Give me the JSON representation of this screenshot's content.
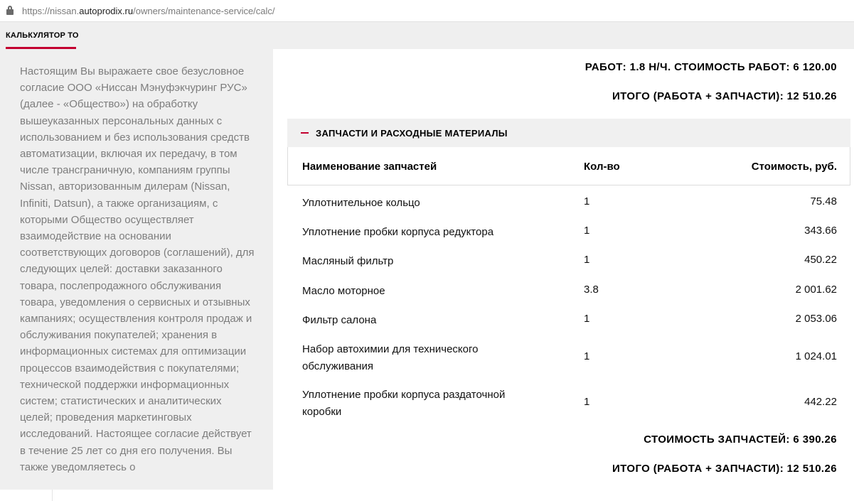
{
  "browser": {
    "url_prefix": "https://nissan.",
    "url_domain": "autoprodix.ru",
    "url_path": "/owners/maintenance-service/calc/"
  },
  "tab": {
    "label": "КАЛЬКУЛЯТОР ТО"
  },
  "consent": {
    "text": "Настоящим Вы выражаете свое безусловное согласие ООО «Ниссан Мэнуфэкчуринг РУС» (далее - «Общество») на обработку вышеуказанных персональных данных с использованием и без использования средств автоматизации, включая их передачу, в том числе трансграничную, компаниям группы Nissan, авторизованным дилерам (Nissan, Infiniti, Datsun), а также организациям, с которыми Общество осуществляет взаимодействие на основании соответствующих договоров (соглашений), для следующих целей: доставки заказанного товара, послепродажного обслуживания товара, уведомления о сервисных и отзывных кампаниях; осуществления контроля продаж и обслуживания покупателей; хранения в информационных системах для оптимизации процессов взаимодействия с покупателями; технической поддержки информационных систем; статистических и аналитических целей; проведения маркетинговых исследований. Настоящее согласие действует в течение 25 лет со дня его получения. Вы также уведомляетесь о"
  },
  "summary": {
    "work_line": "РАБОТ: 1.8 Н/Ч. СТОИМОСТЬ РАБОТ: 6 120.00",
    "total_top": "ИТОГО (РАБОТА + ЗАПЧАСТИ): 12 510.26",
    "parts_cost": "СТОИМОСТЬ ЗАПЧАСТЕЙ: 6 390.26",
    "total_bottom": "ИТОГО (РАБОТА + ЗАПЧАСТИ): 12 510.26"
  },
  "parts": {
    "section_title": "ЗАПЧАСТИ И РАСХОДНЫЕ МАТЕРИАЛЫ",
    "columns": {
      "name": "Наименование запчастей",
      "qty": "Кол-во",
      "cost": "Стоимость, руб."
    },
    "rows": [
      {
        "name": "Уплотнительное кольцо",
        "qty": "1",
        "cost": "75.48"
      },
      {
        "name": "Уплотнение пробки корпуса редуктора",
        "qty": "1",
        "cost": "343.66"
      },
      {
        "name": "Масляный фильтр",
        "qty": "1",
        "cost": "450.22"
      },
      {
        "name": "Масло моторное",
        "qty": "3.8",
        "cost": "2 001.62"
      },
      {
        "name": "Фильтр салона",
        "qty": "1",
        "cost": "2 053.06"
      },
      {
        "name": "Набор автохимии для технического обслуживания",
        "qty": "1",
        "cost": "1 024.01"
      },
      {
        "name": "Уплотнение пробки корпуса раздаточной коробки",
        "qty": "1",
        "cost": "442.22"
      }
    ]
  },
  "colors": {
    "accent": "#c3002f",
    "panel_bg": "#efefef",
    "consent_text": "#7d7d7d"
  },
  "icons": {
    "lock": "lock-icon",
    "section_toggle": "minus-icon"
  }
}
